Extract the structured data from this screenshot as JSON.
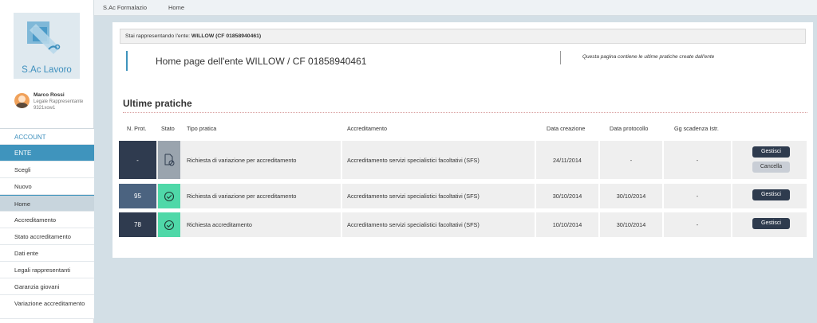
{
  "app": {
    "logo_text": "S.Ac Lavoro"
  },
  "user": {
    "name": "Marco Rossi",
    "role": "Legale Rappresentante",
    "code": "9321xow1"
  },
  "sidebar": {
    "items": [
      {
        "label": "ACCOUNT"
      },
      {
        "label": "ENTE"
      },
      {
        "label": "Scegli"
      },
      {
        "label": "Nuovo"
      },
      {
        "label": "Home"
      },
      {
        "label": "Accreditamento"
      },
      {
        "label": "Stato accreditamento"
      },
      {
        "label": "Dati ente"
      },
      {
        "label": "Legali rappresentanti"
      },
      {
        "label": "Garanzia giovani"
      },
      {
        "label": "Variazione accreditamento"
      }
    ]
  },
  "topbar": {
    "link1": "S.Ac Formalazio",
    "link2": "Home"
  },
  "ente_bar": {
    "prefix": "Stai rappresentando l'ente: ",
    "ente": "WILLOW (CF 01858940461)"
  },
  "header": {
    "title": "Home page dell'ente WILLOW / CF 01858940461",
    "note": "Questa pagina contiene le ultime pratiche create dall'ente"
  },
  "section": {
    "title": "Ultime pratiche"
  },
  "table": {
    "headers": {
      "prot": "N. Prot.",
      "stato": "Stato",
      "tipo": "Tipo pratica",
      "accr": "Accreditamento",
      "creazione": "Data creazione",
      "protocollo": "Data protocollo",
      "scadenza": "Gg scadenza Istr."
    },
    "rows": [
      {
        "prot": "-",
        "tipo": "Richiesta di variazione per accreditamento",
        "accr": "Accreditamento servizi specialistici facoltativi (SFS)",
        "creazione": "24/11/2014",
        "protocollo": "-",
        "scadenza": "-",
        "btn_manage": "Gestisci",
        "btn_cancel": "Cancella",
        "status_icon": "pending-document-icon",
        "prot_color": "#2f3b4f",
        "status_color": "#9aa4ae"
      },
      {
        "prot": "95",
        "tipo": "Richiesta di variazione per accreditamento",
        "accr": "Accreditamento servizi specialistici facoltativi (SFS)",
        "creazione": "30/10/2014",
        "protocollo": "30/10/2014",
        "scadenza": "-",
        "btn_manage": "Gestisci",
        "status_icon": "check-circle-icon",
        "prot_color": "#4b6380",
        "status_color": "#4fd8a8"
      },
      {
        "prot": "78",
        "tipo": "Richiesta accreditamento",
        "accr": "Accreditamento servizi specialistici facoltativi (SFS)",
        "creazione": "10/10/2014",
        "protocollo": "30/10/2014",
        "scadenza": "-",
        "btn_manage": "Gestisci",
        "status_icon": "check-circle-icon",
        "prot_color": "#2f3b4f",
        "status_color": "#4fd8a8"
      }
    ]
  },
  "colors": {
    "accent": "#3f94bd",
    "dark_button": "#2e3b4e",
    "success": "#4fd8a8",
    "background": "#d3dfe6"
  }
}
